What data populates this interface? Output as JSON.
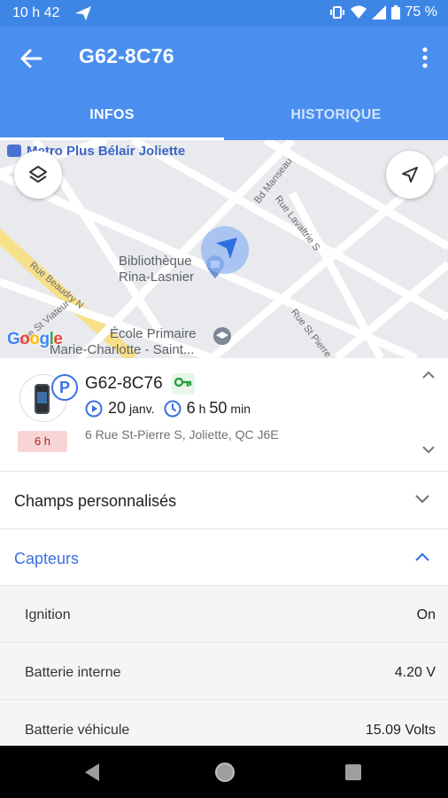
{
  "status_bar": {
    "time": "10 h 42",
    "battery": "75 %"
  },
  "app_bar": {
    "title": "G62-8C76"
  },
  "tabs": [
    {
      "label": "INFOS",
      "active": true
    },
    {
      "label": "HISTORIQUE",
      "active": false
    }
  ],
  "map": {
    "poi_store": "Metro Plus Bélair Joliette",
    "poi_library_line1": "Bibliothèque",
    "poi_library_line2": "Rina-Lasnier",
    "poi_school_line1": "École Primaire",
    "poi_school_line2": "Marie-Charlotte - Saint...",
    "streets": [
      "Bd Manseau",
      "Rue Lavaltrie S",
      "Rue Beaudry N",
      "Rue St Viateur",
      "Rue St Pierre"
    ],
    "logo": "Google"
  },
  "vehicle": {
    "name": "G62-8C76",
    "parking_symbol": "P",
    "duration_badge": "6 h",
    "date_day": "20",
    "date_month": "janv.",
    "elapsed_hours": "6",
    "elapsed_hours_unit": "h",
    "elapsed_minutes": "50",
    "elapsed_minutes_unit": "min",
    "address": "6 Rue St-Pierre S, Joliette, QC J6E"
  },
  "sections": {
    "custom_fields": "Champs personnalisés",
    "sensors": "Capteurs"
  },
  "sensors": [
    {
      "name": "Ignition",
      "value": "On"
    },
    {
      "name": "Batterie interne",
      "value": "4.20 V"
    },
    {
      "name": "Batterie véhicule",
      "value": "15.09 Volts"
    }
  ],
  "colors": {
    "primary": "#4a8ef0",
    "accent": "#3a72e0",
    "duration_badge_bg": "#f9d4d4"
  }
}
